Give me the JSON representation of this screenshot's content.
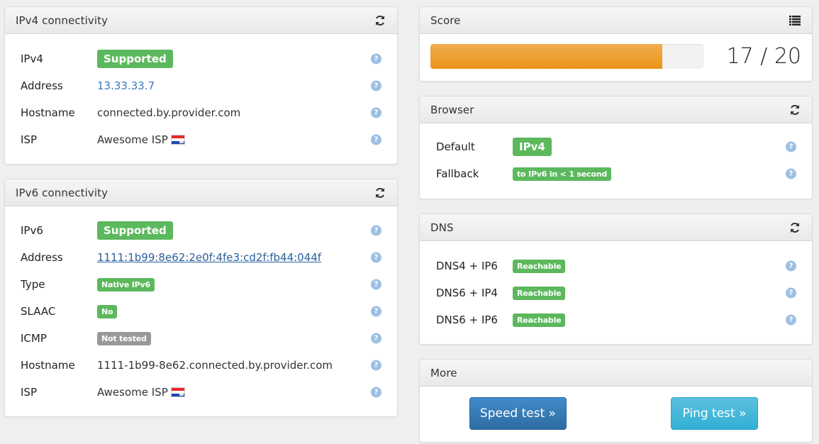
{
  "ipv4": {
    "title": "IPv4 connectivity",
    "header_icon": "refresh-icon",
    "rows": [
      {
        "label": "IPv4",
        "value": "Supported",
        "kind": "badge-lg"
      },
      {
        "label": "Address",
        "value": "13.33.33.7",
        "kind": "link"
      },
      {
        "label": "Hostname",
        "value": "connected.by.provider.com",
        "kind": "text"
      },
      {
        "label": "ISP",
        "value": "Awesome ISP",
        "kind": "isp",
        "flag": "NL"
      }
    ]
  },
  "ipv6": {
    "title": "IPv6 connectivity",
    "header_icon": "refresh-icon",
    "rows": [
      {
        "label": "IPv6",
        "value": "Supported",
        "kind": "badge-lg"
      },
      {
        "label": "Address",
        "value": "1111:1b99:8e62:2e0f:4fe3:cd2f:fb44:044f",
        "kind": "link-ul"
      },
      {
        "label": "Type",
        "value": "Native IPv6",
        "kind": "badge-sm"
      },
      {
        "label": "SLAAC",
        "value": "No",
        "kind": "badge-sm"
      },
      {
        "label": "ICMP",
        "value": "Not tested",
        "kind": "badge-sm-grey"
      },
      {
        "label": "Hostname",
        "value": "1111-1b99-8e62.connected.by.provider.com",
        "kind": "text"
      },
      {
        "label": "ISP",
        "value": "Awesome ISP",
        "kind": "isp",
        "flag": "NL"
      }
    ]
  },
  "score": {
    "title": "Score",
    "header_icon": "list-icon",
    "value": 17,
    "max": 20,
    "text": "17 / 20",
    "bar_color": "#ec971f"
  },
  "browser": {
    "title": "Browser",
    "header_icon": "refresh-icon",
    "rows": [
      {
        "label": "Default",
        "value": "IPv4",
        "kind": "badge-lg"
      },
      {
        "label": "Fallback",
        "value": "to IPv6 in < 1 second",
        "kind": "badge-sm"
      }
    ]
  },
  "dns": {
    "title": "DNS",
    "header_icon": "refresh-icon",
    "rows": [
      {
        "label": "DNS4 + IP6",
        "value": "Reachable",
        "kind": "badge-sm"
      },
      {
        "label": "DNS6 + IP4",
        "value": "Reachable",
        "kind": "badge-sm"
      },
      {
        "label": "DNS6 + IP6",
        "value": "Reachable",
        "kind": "badge-sm"
      }
    ]
  },
  "more": {
    "title": "More",
    "speed_test": "Speed test »",
    "ping_test": "Ping test »"
  },
  "colors": {
    "success": "#5cb85c",
    "default_badge": "#999999",
    "help": "#9dc0e3",
    "primary": "#337ab7",
    "info": "#5bc0de"
  },
  "help_glyph": "?"
}
